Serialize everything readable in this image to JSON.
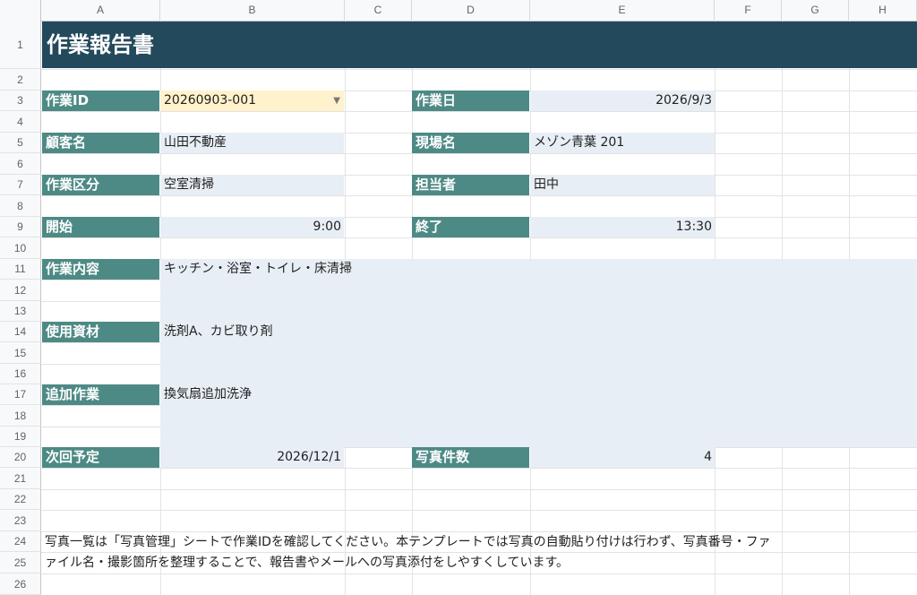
{
  "columns": [
    "A",
    "B",
    "C",
    "D",
    "E",
    "F",
    "G",
    "H"
  ],
  "rows": [
    "1",
    "2",
    "3",
    "4",
    "5",
    "6",
    "7",
    "8",
    "9",
    "10",
    "11",
    "12",
    "13",
    "14",
    "15",
    "16",
    "17",
    "18",
    "19",
    "20",
    "21",
    "22",
    "23",
    "24",
    "25",
    "26"
  ],
  "title": "作業報告書",
  "fields": {
    "work_id_label": "作業ID",
    "work_id_value": "20260903-001",
    "work_date_label": "作業日",
    "work_date_value": "2026/9/3",
    "customer_label": "顧客名",
    "customer_value": "山田不動産",
    "site_label": "現場名",
    "site_value": "メゾン青葉 201",
    "category_label": "作業区分",
    "category_value": "空室清掃",
    "staff_label": "担当者",
    "staff_value": "田中",
    "start_label": "開始",
    "start_value": "9:00",
    "end_label": "終了",
    "end_value": "13:30",
    "content_label": "作業内容",
    "content_value": "キッチン・浴室・トイレ・床清掃",
    "materials_label": "使用資材",
    "materials_value": "洗剤A、カビ取り剤",
    "extra_label": "追加作業",
    "extra_value": "換気扇追加洗浄",
    "next_label": "次回予定",
    "next_value": "2026/12/1",
    "photos_label": "写真件数",
    "photos_value": "4"
  },
  "notes": {
    "line1": "写真一覧は「写真管理」シートで作業IDを確認してください。本テンプレートでは写真の自動貼り付けは行わず、写真番号・ファ",
    "line2": "ァイル名・撮影箇所を整理することで、報告書やメールへの写真添付をしやすくしています。"
  },
  "icons": {
    "dropdown": "dropdown-arrow-icon"
  },
  "colors": {
    "title_bg": "#234a5c",
    "label_bg": "#4e8a85",
    "value_bg": "#e8eef5",
    "id_bg": "#fff2cc"
  }
}
